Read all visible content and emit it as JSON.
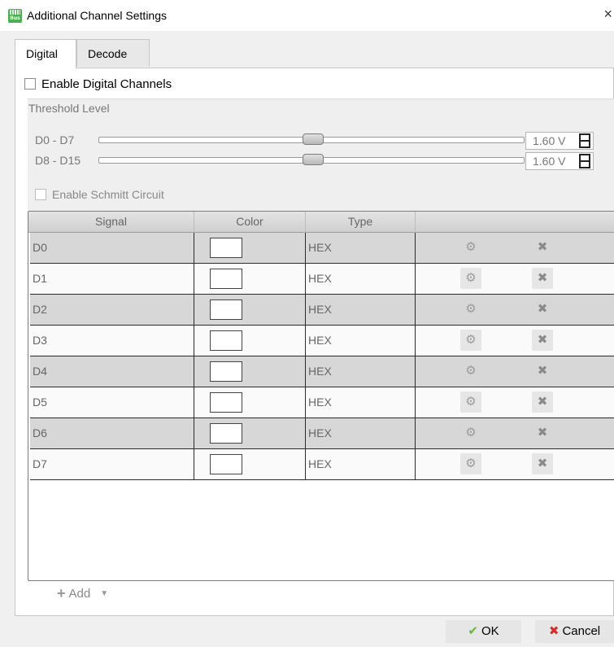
{
  "window": {
    "title": "Additional Channel Settings",
    "app_icon_text": "Bus",
    "close_label": "×"
  },
  "tabs": [
    {
      "label": "Digital",
      "active": true
    },
    {
      "label": "Decode",
      "active": false
    }
  ],
  "digital": {
    "enable_label": "Enable Digital Channels",
    "enabled": false,
    "threshold": {
      "title": "Threshold Level",
      "groups": [
        {
          "label": "D0 - D7",
          "value": "1.60 V",
          "slider_fraction": 0.5
        },
        {
          "label": "D8 - D15",
          "value": "1.60 V",
          "slider_fraction": 0.5
        }
      ],
      "schmitt_label": "Enable Schmitt Circuit",
      "schmitt_enabled": false
    },
    "table": {
      "headers": [
        "Signal",
        "Color",
        "Type",
        ""
      ],
      "rows": [
        {
          "signal": "D0",
          "color": "#ffffff",
          "type": "HEX"
        },
        {
          "signal": "D1",
          "color": "#ffffff",
          "type": "HEX"
        },
        {
          "signal": "D2",
          "color": "#ffffff",
          "type": "HEX"
        },
        {
          "signal": "D3",
          "color": "#ffffff",
          "type": "HEX"
        },
        {
          "signal": "D4",
          "color": "#ffffff",
          "type": "HEX"
        },
        {
          "signal": "D5",
          "color": "#ffffff",
          "type": "HEX"
        },
        {
          "signal": "D6",
          "color": "#ffffff",
          "type": "HEX"
        },
        {
          "signal": "D7",
          "color": "#ffffff",
          "type": "HEX"
        }
      ],
      "row_actions": {
        "settings_icon": "gear-icon",
        "delete_icon": "close-icon"
      }
    },
    "add_label": "Add"
  },
  "footer": {
    "ok_label": "OK",
    "cancel_label": "Cancel"
  },
  "colors": {
    "ok_check": "#6cb33f",
    "cancel_x": "#d32f2f",
    "app_icon": "#4caf50"
  }
}
